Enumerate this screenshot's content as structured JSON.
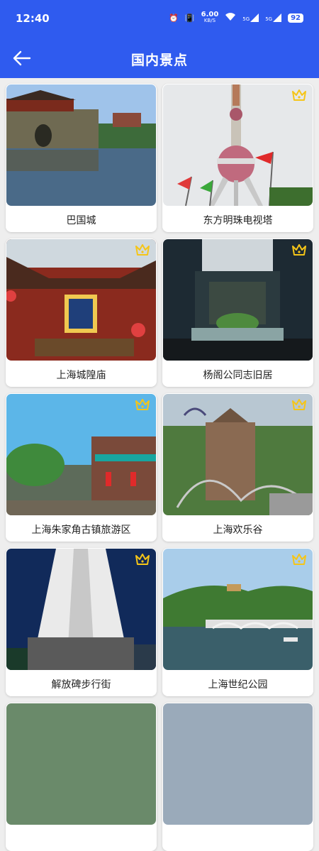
{
  "status": {
    "time": "12:40",
    "net_speed_value": "6.00",
    "net_speed_unit": "KB/S",
    "sig1": "5G",
    "sig2": "5G",
    "battery": "92"
  },
  "header": {
    "title": "国内景点",
    "back_icon": "arrow-left-icon"
  },
  "colors": {
    "primary": "#2f5bef",
    "crown": "#f5c518"
  },
  "attractions": [
    {
      "name": "巴国城",
      "vip": false
    },
    {
      "name": "东方明珠电视塔",
      "vip": true
    },
    {
      "name": "上海城隍庙",
      "vip": true
    },
    {
      "name": "杨阁公同志旧居",
      "vip": true
    },
    {
      "name": "上海朱家角古镇旅游区",
      "vip": true
    },
    {
      "name": "上海欢乐谷",
      "vip": true
    },
    {
      "name": "解放碑步行街",
      "vip": true
    },
    {
      "name": "上海世纪公园",
      "vip": true
    }
  ]
}
